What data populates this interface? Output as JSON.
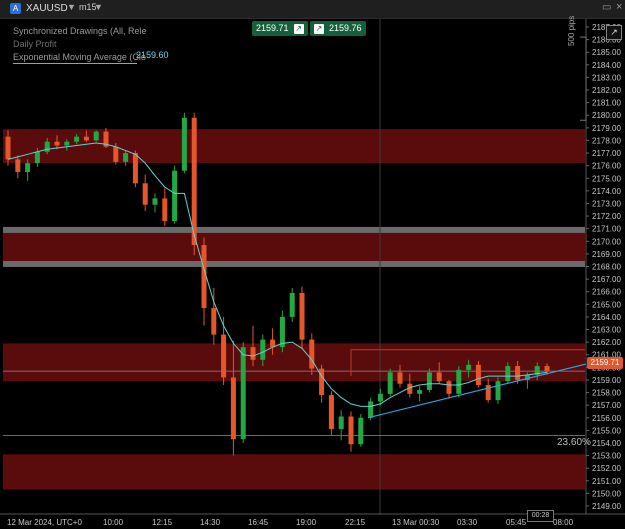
{
  "toolbar": {
    "symbol_icon_letter": "A",
    "symbol": "XAUUSD",
    "symbol_caret": "▼",
    "timeframe_icon": "m15",
    "timeframe_caret": "▼",
    "popout_icon": "popout-window-icon",
    "close_icon": "close-icon"
  },
  "legend": {
    "line1": "Synchronized Drawings (All, Rele",
    "line2": "Daily Profit",
    "line3": "Exponential Moving Average (Clo",
    "ema_value": "2159.60"
  },
  "price_buttons": {
    "sell": "2159.71",
    "buy": "2159.76",
    "arrow": "↗"
  },
  "pips_label": "500 pips",
  "fib_label": "23.60%",
  "current_price": "2159.71",
  "countdown": "00:28",
  "colors": {
    "bull": "#23a846",
    "bear": "#e5562b",
    "ema": "#5fd3d3",
    "zone": "#5a0c0c",
    "grey_band": "#6a6a6a",
    "trendline": "#2aa3e0",
    "price_tag": "#e0582e",
    "button": "#15603a"
  },
  "chart_data": {
    "type": "candlestick",
    "symbol": "XAUUSD",
    "timeframe": "m15",
    "y_ticks": [
      2187.0,
      2186.0,
      2185.0,
      2184.0,
      2183.0,
      2182.0,
      2181.0,
      2180.0,
      2179.0,
      2178.0,
      2177.0,
      2176.0,
      2175.0,
      2174.0,
      2173.0,
      2172.0,
      2171.0,
      2170.0,
      2169.0,
      2168.0,
      2167.0,
      2166.0,
      2165.0,
      2164.0,
      2163.0,
      2162.0,
      2161.0,
      2160.0,
      2159.0,
      2158.0,
      2157.0,
      2156.0,
      2155.0,
      2154.0,
      2153.0,
      2152.0,
      2151.0,
      2150.0,
      2149.0
    ],
    "x_ticks": [
      "12 Mar 2024, UTC+0",
      "10:00",
      "12:15",
      "14:30",
      "16:45",
      "19:00",
      "22:15",
      "13 Mar 00:30",
      "03:30",
      "05:45",
      "08:00"
    ],
    "zones": [
      [
        2176.2,
        2178.9
      ],
      [
        2168.3,
        2170.9
      ],
      [
        2158.9,
        2161.9
      ],
      [
        2150.3,
        2153.1
      ]
    ],
    "grey_lines": [
      2170.9,
      2168.2
    ],
    "horizontal_lines": [
      2159.7,
      2154.6
    ],
    "fib_level": "23.60%",
    "trendline_points": [
      [
        2156.0,
        2160.3
      ]
    ],
    "resistance_level": 2161.4,
    "ema": [
      2176.5,
      2176.7,
      2176.9,
      2177.1,
      2177.3,
      2177.4,
      2177.5,
      2177.6,
      2177.7,
      2177.8,
      2177.7,
      2177.5,
      2177.2,
      2176.9,
      2176.2,
      2175.2,
      2174.3,
      2173.8,
      2173.8,
      2170.5,
      2167.8,
      2165.2,
      2163.3,
      2161.9,
      2161.0,
      2160.9,
      2161.2,
      2161.6,
      2161.9,
      2162.0,
      2161.5,
      2160.6,
      2159.3,
      2158.3,
      2157.6,
      2157.1,
      2156.9,
      2156.9,
      2157.1,
      2157.6,
      2158.0,
      2158.4,
      2158.6,
      2158.7,
      2158.7,
      2158.6,
      2158.6,
      2158.8,
      2159.1,
      2159.3,
      2159.3,
      2159.3,
      2159.3,
      2159.4,
      2159.5,
      2159.6
    ],
    "candles": [
      [
        2178.3,
        2178.8,
        2176.0,
        2176.5
      ],
      [
        2176.5,
        2176.8,
        2175.0,
        2175.5
      ],
      [
        2175.5,
        2176.5,
        2174.8,
        2176.2
      ],
      [
        2176.2,
        2177.4,
        2175.9,
        2177.1
      ],
      [
        2177.1,
        2178.2,
        2176.9,
        2177.9
      ],
      [
        2177.9,
        2178.4,
        2177.3,
        2177.6
      ],
      [
        2177.6,
        2178.1,
        2177.2,
        2177.9
      ],
      [
        2177.9,
        2178.5,
        2177.7,
        2178.3
      ],
      [
        2178.3,
        2178.8,
        2177.9,
        2178.0
      ],
      [
        2178.0,
        2178.8,
        2177.9,
        2178.7
      ],
      [
        2178.7,
        2179.0,
        2177.4,
        2177.5
      ],
      [
        2177.5,
        2177.8,
        2176.1,
        2176.3
      ],
      [
        2176.3,
        2177.2,
        2176.0,
        2177.0
      ],
      [
        2177.0,
        2177.2,
        2174.3,
        2174.6
      ],
      [
        2174.6,
        2175.3,
        2172.4,
        2172.9
      ],
      [
        2172.9,
        2173.8,
        2172.3,
        2173.4
      ],
      [
        2173.4,
        2174.2,
        2171.2,
        2171.6
      ],
      [
        2171.6,
        2176.0,
        2171.4,
        2175.6
      ],
      [
        2175.6,
        2180.2,
        2175.4,
        2179.8
      ],
      [
        2179.8,
        2180.2,
        2168.9,
        2169.7
      ],
      [
        2169.7,
        2170.3,
        2163.3,
        2164.7
      ],
      [
        2164.7,
        2166.3,
        2161.8,
        2162.6
      ],
      [
        2162.6,
        2164.0,
        2158.6,
        2159.2
      ],
      [
        2159.2,
        2162.1,
        2153.0,
        2154.3
      ],
      [
        2154.3,
        2162.0,
        2154.0,
        2161.6
      ],
      [
        2161.6,
        2163.3,
        2160.1,
        2160.6
      ],
      [
        2160.6,
        2162.6,
        2160.1,
        2162.2
      ],
      [
        2162.2,
        2163.1,
        2161.0,
        2161.6
      ],
      [
        2161.6,
        2164.5,
        2161.2,
        2164.0
      ],
      [
        2164.0,
        2166.3,
        2163.6,
        2165.9
      ],
      [
        2165.9,
        2166.4,
        2161.5,
        2162.2
      ],
      [
        2162.2,
        2162.7,
        2159.4,
        2159.9
      ],
      [
        2159.9,
        2160.2,
        2157.2,
        2157.8
      ],
      [
        2157.8,
        2158.1,
        2154.6,
        2155.1
      ],
      [
        2155.1,
        2156.6,
        2154.2,
        2156.1
      ],
      [
        2156.1,
        2156.5,
        2153.3,
        2153.9
      ],
      [
        2153.9,
        2156.3,
        2153.7,
        2156.0
      ],
      [
        2156.0,
        2157.6,
        2155.8,
        2157.3
      ],
      [
        2157.3,
        2158.3,
        2157.0,
        2157.9
      ],
      [
        2157.9,
        2159.9,
        2157.7,
        2159.6
      ],
      [
        2159.6,
        2160.2,
        2158.4,
        2158.7
      ],
      [
        2158.7,
        2159.5,
        2157.6,
        2157.9
      ],
      [
        2157.9,
        2158.5,
        2157.3,
        2158.2
      ],
      [
        2158.2,
        2159.9,
        2158.0,
        2159.6
      ],
      [
        2159.6,
        2160.4,
        2158.7,
        2158.9
      ],
      [
        2158.9,
        2159.0,
        2157.5,
        2157.9
      ],
      [
        2157.9,
        2160.1,
        2157.6,
        2159.8
      ],
      [
        2159.8,
        2160.6,
        2159.2,
        2160.2
      ],
      [
        2160.2,
        2160.5,
        2158.4,
        2158.6
      ],
      [
        2158.6,
        2159.1,
        2157.2,
        2157.4
      ],
      [
        2157.4,
        2159.2,
        2157.1,
        2158.9
      ],
      [
        2158.9,
        2160.4,
        2158.7,
        2160.1
      ],
      [
        2160.1,
        2160.5,
        2158.7,
        2159.0
      ],
      [
        2159.0,
        2159.6,
        2158.3,
        2159.4
      ],
      [
        2159.4,
        2160.4,
        2159.0,
        2160.1
      ],
      [
        2160.1,
        2160.3,
        2159.4,
        2159.7
      ]
    ]
  }
}
